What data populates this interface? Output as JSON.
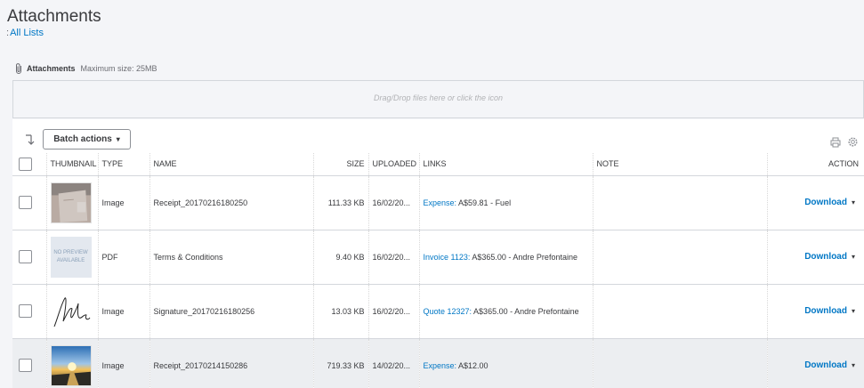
{
  "page": {
    "title": "Attachments",
    "back_cue": ":",
    "back_link": "All Lists"
  },
  "attachments_header": {
    "label": "Attachments",
    "max_size": "Maximum size: 25MB"
  },
  "dropzone": {
    "text": "Drag/Drop files here or click the icon"
  },
  "toolbar": {
    "batch_actions": "Batch actions",
    "batch_caret": "▾",
    "icons": [
      "sort-toggle-icon",
      "print-icon",
      "gear-icon"
    ]
  },
  "table": {
    "columns": {
      "thumbnail": "THUMBNAIL",
      "type": "TYPE",
      "name": "NAME",
      "size": "SIZE",
      "uploaded": "UPLOADED",
      "links": "LINKS",
      "note": "NOTE",
      "action": "ACTION"
    },
    "rows": [
      {
        "thumbnail": "photo",
        "type": "Image",
        "name": "Receipt_20170216180250",
        "size": "111.33 KB",
        "uploaded": "16/02/20...",
        "link_label": "Expense:",
        "link_detail": " A$59.81 - Fuel",
        "note": "",
        "action": "Download",
        "action_caret": "▾"
      },
      {
        "thumbnail": "no-preview",
        "thumb_text_1": "NO PREVIEW",
        "thumb_text_2": "AVAILABLE",
        "type": "PDF",
        "name": "Terms & Conditions",
        "size": "9.40 KB",
        "uploaded": "16/02/20...",
        "link_label": "Invoice 1123:",
        "link_detail": " A$365.00 - Andre Prefontaine",
        "note": "",
        "action": "Download",
        "action_caret": "▾"
      },
      {
        "thumbnail": "signature",
        "type": "Image",
        "name": "Signature_20170216180256",
        "size": "13.03 KB",
        "uploaded": "16/02/20...",
        "link_label": "Quote 12327:",
        "link_detail": " A$365.00 - Andre Prefontaine",
        "note": "",
        "action": "Download",
        "action_caret": "▾"
      },
      {
        "thumbnail": "sunset-photo",
        "type": "Image",
        "name": "Receipt_20170214150286",
        "size": "719.33 KB",
        "uploaded": "14/02/20...",
        "link_label": "Expense:",
        "link_detail": " A$12.00",
        "note": "",
        "action": "Download",
        "action_caret": "▾"
      }
    ]
  },
  "colors": {
    "link": "#0077c5",
    "text": "#393a3d",
    "highlight_row": "#eceef1",
    "background": "#f4f5f8"
  }
}
